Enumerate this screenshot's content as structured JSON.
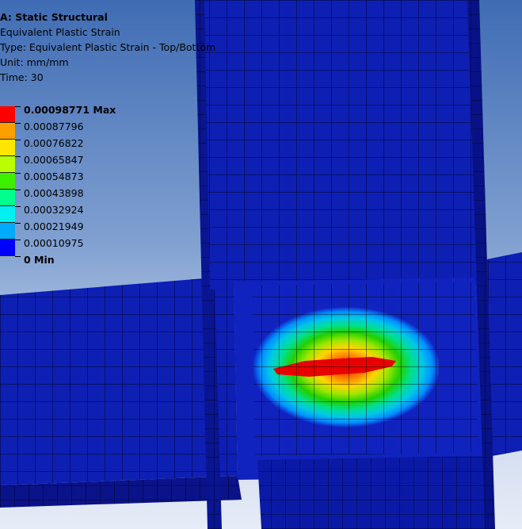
{
  "info": {
    "analysis": "A: Static Structural",
    "result": "Equivalent Plastic Strain",
    "type": "Type: Equivalent Plastic Strain - Top/Bottom",
    "unit": "Unit: mm/mm",
    "time": "Time: 30"
  },
  "legend": {
    "max_label": "0.00098771 Max",
    "min_label": "0 Min",
    "levels": [
      "0.00087796",
      "0.00076822",
      "0.00065847",
      "0.00054873",
      "0.00043898",
      "0.00032924",
      "0.00021949",
      "0.00010975"
    ],
    "colors": [
      "#ff0000",
      "#ff9e00",
      "#ffe600",
      "#b8ff00",
      "#3cf000",
      "#00ff8c",
      "#00f0f0",
      "#00aaff",
      "#0000ff"
    ]
  },
  "mesh_color": "#0a1a8c",
  "mesh_line": "#000000"
}
